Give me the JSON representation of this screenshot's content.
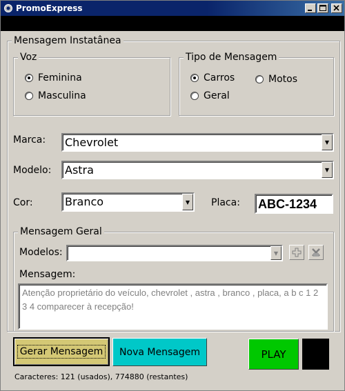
{
  "window": {
    "title": "PromoExpress"
  },
  "panel": {
    "legend": "Mensagem Instatânea"
  },
  "voz": {
    "legend": "Voz",
    "options": [
      {
        "label": "Feminina",
        "checked": true
      },
      {
        "label": "Masculina",
        "checked": false
      }
    ]
  },
  "tipo": {
    "legend": "Tipo de Mensagem",
    "options": [
      {
        "label": "Carros",
        "checked": true
      },
      {
        "label": "Motos",
        "checked": false
      },
      {
        "label": "Geral",
        "checked": false
      }
    ]
  },
  "marca": {
    "label": "Marca:",
    "value": "Chevrolet"
  },
  "modelo": {
    "label": "Modelo:",
    "value": "Astra"
  },
  "cor": {
    "label": "Cor:",
    "value": "Branco"
  },
  "placa": {
    "label": "Placa:",
    "value": "ABC-1234"
  },
  "geral": {
    "legend": "Mensagem Geral",
    "modelos_label": "Modelos:",
    "modelos_value": "",
    "mensagem_label": "Mensagem:",
    "mensagem_text": "Atenção proprietário do veículo, chevrolet , astra , branco , placa,  a   b   c   1   2   3   4   comparecer à recepção!"
  },
  "buttons": {
    "gerar": "Gerar Mensagem",
    "nova": "Nova Mensagem",
    "play": "PLAY"
  },
  "status": {
    "text": "Caracteres: 121 (usados), 774880 (restantes)"
  },
  "colors": {
    "window_bg": "#d4d0c8",
    "gerar_bg": "#d4c875",
    "nova_bg": "#00c8c8",
    "play_bg": "#00c800",
    "stop_bg": "#000000",
    "message_text": "#808080"
  },
  "icons": [
    "gear-app-icon",
    "minimize-icon",
    "maximize-icon",
    "close-icon",
    "add-icon",
    "delete-icon",
    "dropdown-arrow-icon"
  ]
}
